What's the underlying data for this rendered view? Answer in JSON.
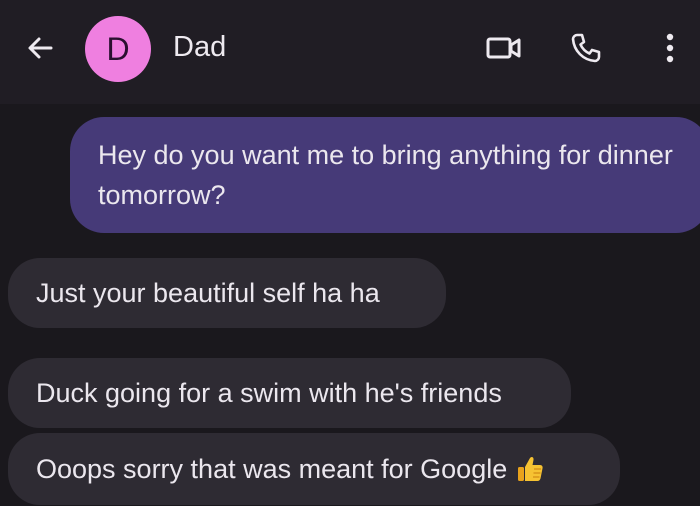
{
  "header": {
    "back_icon": "arrow-left-icon",
    "avatar_letter": "D",
    "avatar_color": "#ef7fe0",
    "contact_name": "Dad",
    "actions": [
      "video-call-icon",
      "phone-icon",
      "more-vert-icon"
    ]
  },
  "messages": [
    {
      "direction": "outgoing",
      "text": "Hey do you want me to bring anything for dinner tomorrow?"
    },
    {
      "direction": "incoming",
      "text": "Just your beautiful self ha ha"
    },
    {
      "direction": "incoming",
      "text": "Duck going for a swim with he's friends"
    },
    {
      "direction": "incoming",
      "text": "Ooops sorry that was meant for Google",
      "emoji": "thumbs-up-icon"
    }
  ],
  "colors": {
    "background": "#1a181d",
    "topbar": "#201d24",
    "outgoing_bubble": "#463a78",
    "incoming_bubble": "#2e2b33",
    "text": "#ebe7ee"
  }
}
